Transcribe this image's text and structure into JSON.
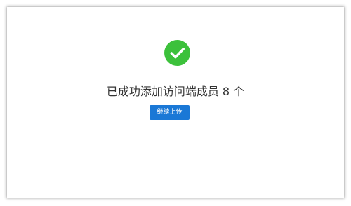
{
  "result": {
    "icon": "check-circle-icon",
    "icon_color": "#3cc13b",
    "message": "已成功添加访问端成员 8 个"
  },
  "actions": {
    "continue_upload_label": "继续上传",
    "button_color": "#1a78d6"
  }
}
